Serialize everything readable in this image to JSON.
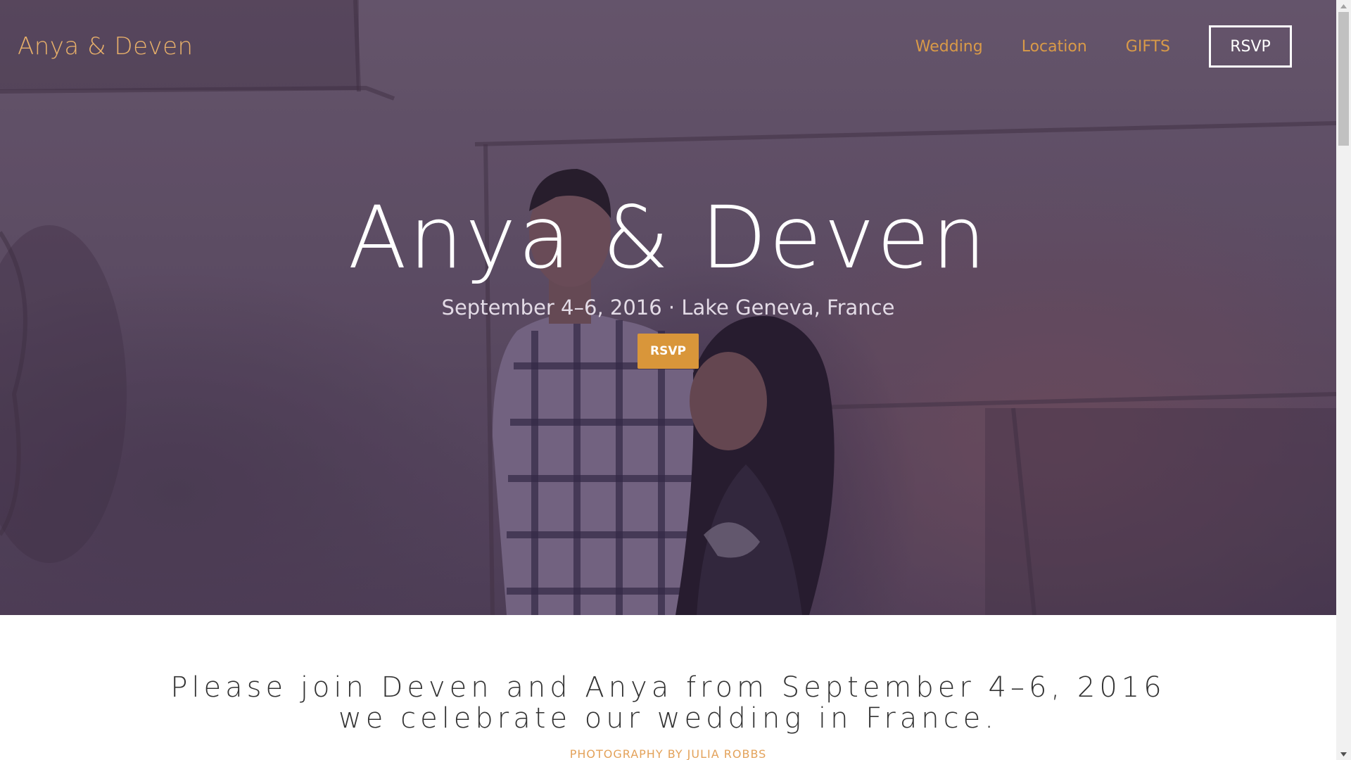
{
  "header": {
    "logo": "Anya & Deven",
    "nav": [
      {
        "label": "Wedding"
      },
      {
        "label": "Location"
      },
      {
        "label": "GIFTS"
      }
    ],
    "rsvp_button": "RSVP"
  },
  "hero": {
    "title": "Anya & Deven",
    "subtitle": "September 4–6, 2016 · Lake Geneva, France",
    "cta": "RSVP"
  },
  "intro": {
    "line1": "Please join Deven and Anya from September 4–6, 2016",
    "line2": "we celebrate our wedding in France.",
    "credit": "PHOTOGRAPHY BY JULIA ROBBS"
  },
  "colors": {
    "accent": "#d9963a",
    "nav_link": "#d99a48",
    "hero_overlay": "#5f5064"
  }
}
